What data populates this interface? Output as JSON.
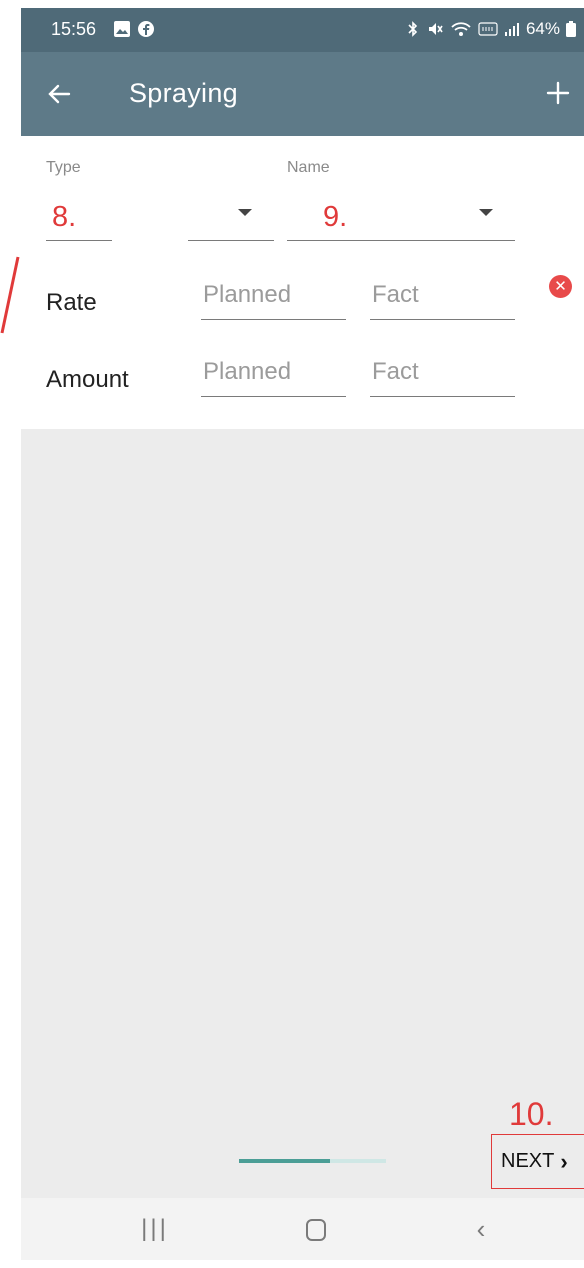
{
  "status_bar": {
    "time": "15:56",
    "icons_left": [
      "gallery-icon",
      "facebook-icon"
    ],
    "icons_right": [
      "bluetooth-icon",
      "mute-icon",
      "wifi-icon",
      "volte-icon",
      "signal-icon"
    ],
    "battery": "64%"
  },
  "app_bar": {
    "title": "Spraying",
    "back_icon": "arrow-left-icon",
    "add_icon": "plus-icon"
  },
  "form": {
    "type": {
      "label": "Type",
      "annotation": "8."
    },
    "name": {
      "label": "Name",
      "annotation": "9."
    },
    "rate": {
      "label": "Rate",
      "planned_placeholder": "Planned",
      "fact_placeholder": "Fact"
    },
    "amount": {
      "label": "Amount",
      "planned_placeholder": "Planned",
      "fact_placeholder": "Fact"
    }
  },
  "footer": {
    "progress": 0.62,
    "next_annotation": "10.",
    "next_label": "NEXT"
  },
  "colors": {
    "status_bar": "#4f6a78",
    "app_bar": "#5e7a88",
    "annotation_red": "#e03a3a",
    "progress_fill": "#4b9e96",
    "progress_track": "#cfe7e5"
  }
}
